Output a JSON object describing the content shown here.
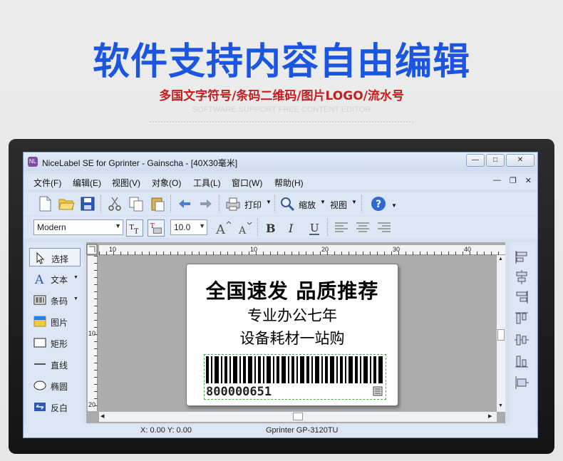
{
  "promo": {
    "headline": "软件支持内容自由编辑",
    "subline": "多国文字符号/条码二维码/图片LOGO/流水号",
    "english": "SOFTWARE SUPPORT FREE CONTENT EDITOR"
  },
  "window": {
    "title": "NiceLabel SE for Gprinter - Gainscha - [40X30毫米]",
    "min_label": "—",
    "max_label": "□",
    "close_label": "✕"
  },
  "menu": [
    "文件(F)",
    "编辑(E)",
    "视图(V)",
    "对象(O)",
    "工具(L)",
    "窗口(W)",
    "帮助(H)"
  ],
  "mdi": {
    "min": "—",
    "restore": "❐",
    "close": "✕"
  },
  "toolbar": {
    "print_label": "打印",
    "zoom_label": "缩放",
    "view_label": "视图",
    "font_name": "Modern",
    "font_size": "10.0"
  },
  "tools": [
    {
      "label": "选择",
      "icon": "cursor-icon"
    },
    {
      "label": "文本",
      "icon": "text-icon"
    },
    {
      "label": "条码",
      "icon": "barcode-icon"
    },
    {
      "label": "图片",
      "icon": "picture-icon"
    },
    {
      "label": "矩形",
      "icon": "rectangle-icon"
    },
    {
      "label": "直线",
      "icon": "line-icon"
    },
    {
      "label": "椭圆",
      "icon": "ellipse-icon"
    },
    {
      "label": "反白",
      "icon": "inverse-icon"
    }
  ],
  "ruler": {
    "h_ticks": [
      "10",
      "10",
      "20",
      "30",
      "40"
    ],
    "v_ticks": [
      "10",
      "20"
    ]
  },
  "label": {
    "line1": "全国速发 品质推荐",
    "line2": "专业办公七年",
    "line3": "设备耗材一站购",
    "barcode_number": "800000651"
  },
  "status": {
    "coords": "X:  0.00 Y:  0.00",
    "printer": "Gprinter  GP-3120TU"
  }
}
